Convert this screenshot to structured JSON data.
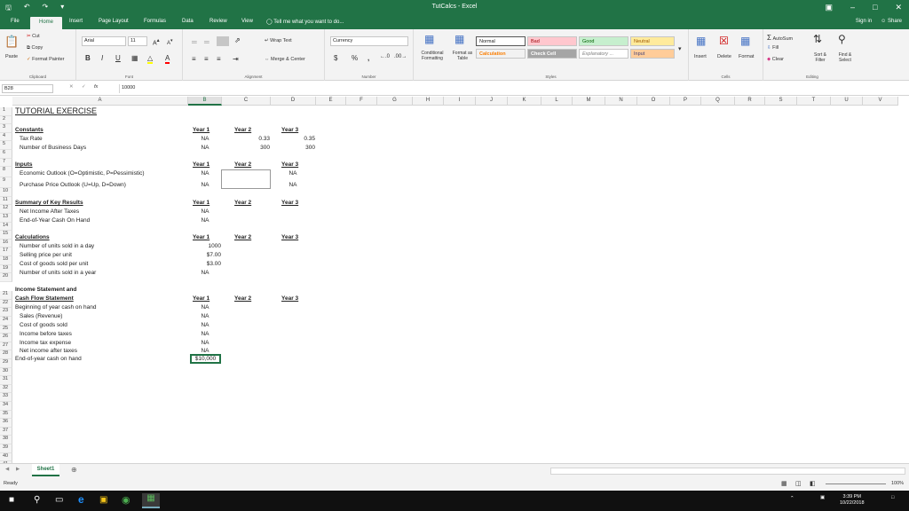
{
  "window": {
    "title": "TutCalcs - Excel",
    "signin": "Sign in",
    "share": "Share"
  },
  "tabs": [
    "File",
    "Home",
    "Insert",
    "Page Layout",
    "Formulas",
    "Data",
    "Review",
    "View"
  ],
  "tell_me": "Tell me what you want to do...",
  "ribbon": {
    "clipboard": {
      "paste": "Paste",
      "cut": "Cut",
      "copy": "Copy",
      "format_painter": "Format Painter",
      "label": "Clipboard"
    },
    "font": {
      "name": "Arial",
      "size": "11",
      "label": "Font"
    },
    "alignment": {
      "wrap": "Wrap Text",
      "merge": "Merge & Center",
      "label": "Alignment"
    },
    "number": {
      "format": "Currency",
      "currency": "$",
      "percent": "%",
      "comma": ",",
      "label": "Number"
    },
    "styles": {
      "conditional": "Conditional Formatting",
      "format_table": "Format as Table",
      "normal": "Normal",
      "bad": "Bad",
      "good": "Good",
      "neutral": "Neutral",
      "calculation": "Calculation",
      "check_cell": "Check Cell",
      "explanatory": "Explanatory ...",
      "input": "Input",
      "label": "Styles"
    },
    "cells": {
      "insert": "Insert",
      "delete": "Delete",
      "format": "Format",
      "label": "Cells"
    },
    "editing": {
      "autosum": "AutoSum",
      "fill": "Fill",
      "clear": "Clear",
      "sort": "Sort & Filter",
      "find": "Find & Select",
      "label": "Editing"
    }
  },
  "formula_bar": {
    "name_box": "B28",
    "fx": "fx",
    "value": "10000"
  },
  "columns": [
    "A",
    "B",
    "C",
    "D",
    "E",
    "F",
    "G",
    "H",
    "I",
    "J",
    "K",
    "L",
    "M",
    "N",
    "O",
    "P",
    "Q",
    "R",
    "S",
    "T",
    "U",
    "V"
  ],
  "sheet": {
    "title": "TUTORIAL EXERCISE",
    "year1": "Year 1",
    "year2": "Year 2",
    "year3": "Year 3",
    "na": "NA",
    "constants": {
      "header": "Constants",
      "tax_rate": "Tax Rate",
      "business_days": "Number of Business Days",
      "tax_y2": "0.33",
      "tax_y3": "0.35",
      "days_y2": "300",
      "days_y3": "300"
    },
    "inputs": {
      "header": "Inputs",
      "economic": "Economic Outlook (O=Optimistic, P=Pessimistic)",
      "purchase": "Purchase Price Outlook (U=Up, D=Down)"
    },
    "summary": {
      "header": "Summary of Key Results",
      "net_income": "Net Income After Taxes",
      "eoy_cash": "End-of-Year Cash On Hand"
    },
    "calculations": {
      "header": "Calculations",
      "units_day": "Number of units sold in a day",
      "price": "Selling price per unit",
      "cogs_unit": "Cost of goods sold per unit",
      "units_year": "Number of units sold in a year",
      "units_day_v": "1000",
      "price_v": "$7.00",
      "cogs_v": "$3.00"
    },
    "income": {
      "header1": "Income Statement and",
      "header2": "Cash Flow Statement",
      "boy_cash": "Beginning of year cash on hand",
      "sales": "Sales (Revenue)",
      "cogs": "Cost of goods sold",
      "pretax": "Income before taxes",
      "tax": "Income tax expense",
      "net": "Net income after taxes",
      "eoy": "End-of-year cash on hand",
      "eoy_v": "$10,000"
    }
  },
  "sheet_tab": "Sheet1",
  "status": {
    "ready": "Ready",
    "zoom": "100%"
  },
  "taskbar": {
    "time": "3:39 PM",
    "date": "10/22/2018"
  },
  "colors": {
    "excel_green": "#217346",
    "bad": "#ffc7ce",
    "good": "#c6efce",
    "neutral": "#ffeb9c",
    "check": "#a5a5a5",
    "input": "#ffcc99"
  }
}
